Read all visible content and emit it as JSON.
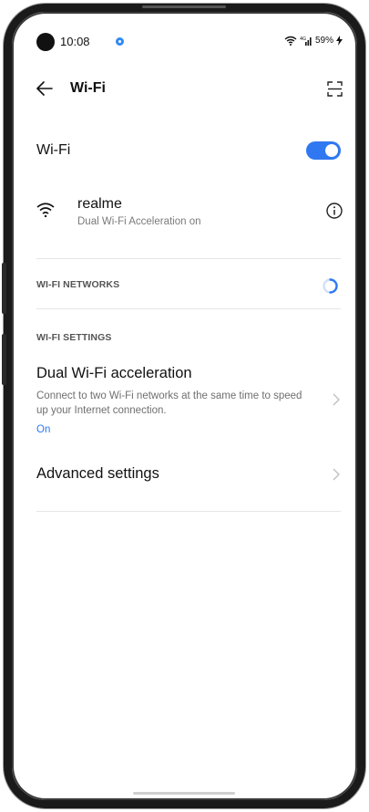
{
  "status_bar": {
    "time": "10:08",
    "battery": "59%"
  },
  "header": {
    "title": "Wi-Fi"
  },
  "wifi_toggle": {
    "label": "Wi-Fi",
    "enabled": true
  },
  "connected_network": {
    "name": "realme",
    "status": "Dual Wi-Fi Acceleration on"
  },
  "sections": {
    "networks_header": "WI-FI NETWORKS",
    "settings_header": "WI-FI SETTINGS"
  },
  "settings": {
    "dual_title": "Dual Wi-Fi acceleration",
    "dual_desc": "Connect to two Wi-Fi networks at the same time to speed up your Internet connection.",
    "dual_value": "On",
    "advanced_title": "Advanced settings"
  },
  "colors": {
    "accent": "#2f78f2",
    "status_dot": "#2f8af7"
  },
  "icons": [
    "back-arrow-icon",
    "scan-icon",
    "wifi-signal-icon",
    "info-icon",
    "loading-spinner-icon",
    "chevron-right-icon"
  ]
}
